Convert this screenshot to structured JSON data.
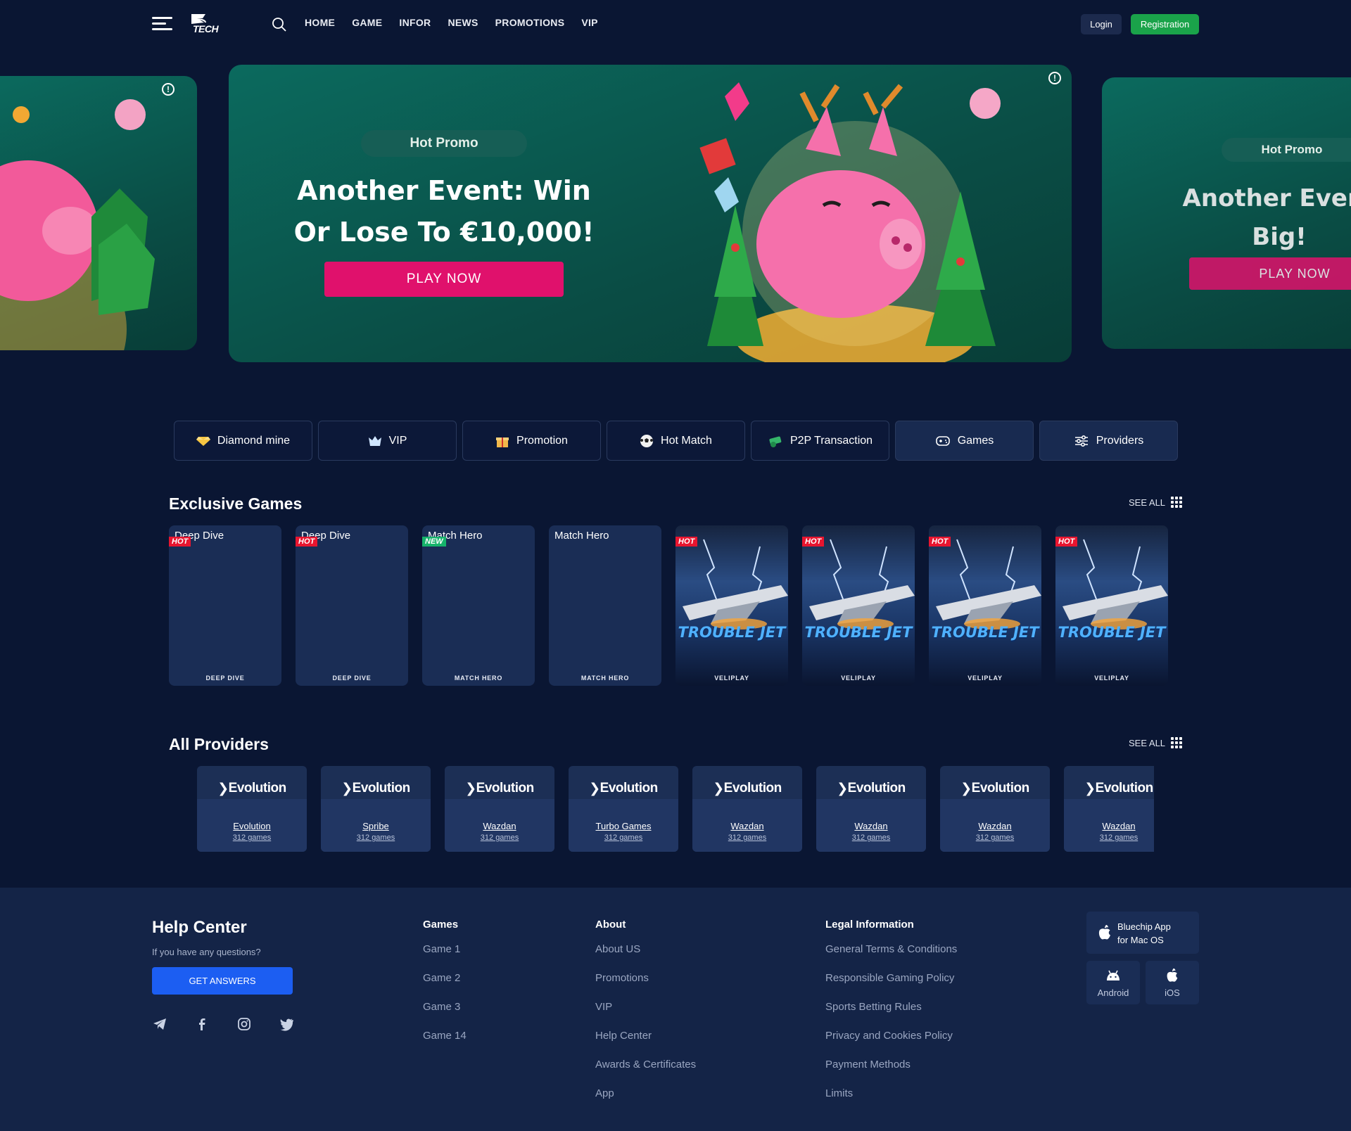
{
  "header": {
    "logo_text": "TECH",
    "nav": [
      "HOME",
      "GAME",
      "INFOR",
      "NEWS",
      "PROMOTIONS",
      "VIP"
    ],
    "login_label": "Login",
    "register_label": "Registration"
  },
  "hero": {
    "main": {
      "badge": "Hot Promo",
      "title_line1": "Another Event: Win",
      "title_line2": "Or Lose To €10,000!",
      "button": "PLAY NOW"
    },
    "right": {
      "badge": "Hot Promo",
      "title_line1": "Another Event",
      "title_line2": "Big!",
      "button": "PLAY NOW"
    }
  },
  "tabs": [
    {
      "label": "Diamond mine",
      "icon": "diamond-icon"
    },
    {
      "label": "VIP",
      "icon": "crown-icon"
    },
    {
      "label": "Promotion",
      "icon": "gift-icon"
    },
    {
      "label": "Hot Match",
      "icon": "soccer-ball-icon"
    },
    {
      "label": "P2P Transaction",
      "icon": "money-icon"
    },
    {
      "label": "Games",
      "icon": "gamepad-icon"
    },
    {
      "label": "Providers",
      "icon": "sliders-icon"
    }
  ],
  "exclusive": {
    "title": "Exclusive Games",
    "see_all": "SEE ALL",
    "games": [
      {
        "title": "Deep Dive",
        "badge": "HOT",
        "footer": "DEEP DIVE"
      },
      {
        "title": "Deep Dive",
        "badge": "HOT",
        "footer": "DEEP DIVE"
      },
      {
        "title": "Match Hero",
        "badge": "NEW",
        "footer": "MATCH HERO"
      },
      {
        "title": "Match Hero",
        "badge": "",
        "footer": "MATCH HERO"
      },
      {
        "title": "TROUBLE JET",
        "badge": "HOT",
        "footer": "VELIPLAY"
      },
      {
        "title": "TROUBLE JET",
        "badge": "HOT",
        "footer": "VELIPLAY"
      },
      {
        "title": "TROUBLE JET",
        "badge": "HOT",
        "footer": "VELIPLAY"
      },
      {
        "title": "TROUBLE JET",
        "badge": "HOT",
        "footer": "VELIPLAY"
      }
    ]
  },
  "providers": {
    "title": "All Providers",
    "see_all": "SEE ALL",
    "logo_text": "Evolution",
    "items": [
      {
        "name": "Evolution",
        "count": "312 games"
      },
      {
        "name": "Spribe",
        "count": "312 games"
      },
      {
        "name": "Wazdan",
        "count": "312 games"
      },
      {
        "name": "Turbo Games",
        "count": "312 games"
      },
      {
        "name": "Wazdan",
        "count": "312 games"
      },
      {
        "name": "Wazdan",
        "count": "312 games"
      },
      {
        "name": "Wazdan",
        "count": "312 games"
      },
      {
        "name": "Wazdan",
        "count": "312 games"
      }
    ]
  },
  "footer": {
    "help_title": "Help Center",
    "help_sub": "If you have any questions?",
    "answers_button": "GET ANSWERS",
    "games": {
      "title": "Games",
      "links": [
        "Game 1",
        "Game 2",
        "Game 3",
        "Game 14"
      ]
    },
    "about": {
      "title": "About",
      "links": [
        "About US",
        "Promotions",
        "VIP",
        "Help Center",
        "Awards & Certificates",
        "App"
      ]
    },
    "legal": {
      "title": "Legal Information",
      "links": [
        "General Terms & Conditions",
        "Responsible Gaming Policy",
        "Sports Betting Rules",
        "Privacy and Cookies Policy",
        "Payment Methods",
        "Limits"
      ]
    },
    "apps": {
      "mac_line1": "Bluechip App",
      "mac_line2": "for Mac OS",
      "android": "Android",
      "ios": "iOS"
    }
  },
  "colors": {
    "background": "#0a1633",
    "accent_pink": "#e0116c",
    "register_green": "#1aa34a",
    "answers_blue": "#1c5ef2",
    "hot_red": "#e8152f",
    "new_green": "#16b36b"
  }
}
